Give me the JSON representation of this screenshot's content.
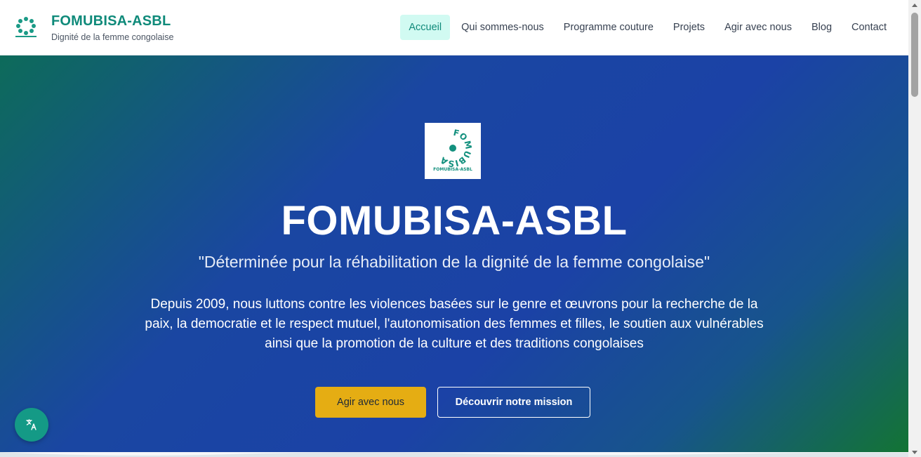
{
  "header": {
    "brand_title": "FOMUBISA-ASBL",
    "brand_subtitle": "Dignité de la femme congolaise",
    "logo_icon": "fomubisa-logo-icon"
  },
  "nav": {
    "items": [
      {
        "label": "Accueil",
        "active": true
      },
      {
        "label": "Qui sommes-nous",
        "active": false
      },
      {
        "label": "Programme couture",
        "active": false
      },
      {
        "label": "Projets",
        "active": false
      },
      {
        "label": "Agir avec nous",
        "active": false
      },
      {
        "label": "Blog",
        "active": false
      },
      {
        "label": "Contact",
        "active": false
      }
    ]
  },
  "hero": {
    "logo_text": "FOMUBISA",
    "logo_caption": "FOMUBISA-ASBL",
    "title": "FOMUBISA-ASBL",
    "quote": "\"Déterminée pour la réhabilitation de la dignité de la femme congolaise\"",
    "description": "Depuis 2009, nous luttons contre les violences basées sur le genre et œuvrons pour la recherche de la paix, la democratie et le respect mutuel, l'autonomisation des femmes et filles, le soutien aux vulnérables ainsi que la promotion de la culture et des traditions congolaises",
    "primary_button": "Agir avec nous",
    "secondary_button": "Découvrir notre mission"
  },
  "fab": {
    "icon": "translate-icon"
  },
  "colors": {
    "brand": "#0f8a7a",
    "accent": "#e5ad13",
    "hero_blue": "#1b42a6",
    "hero_green": "#137434",
    "nav_active_bg": "#d1faf2"
  }
}
